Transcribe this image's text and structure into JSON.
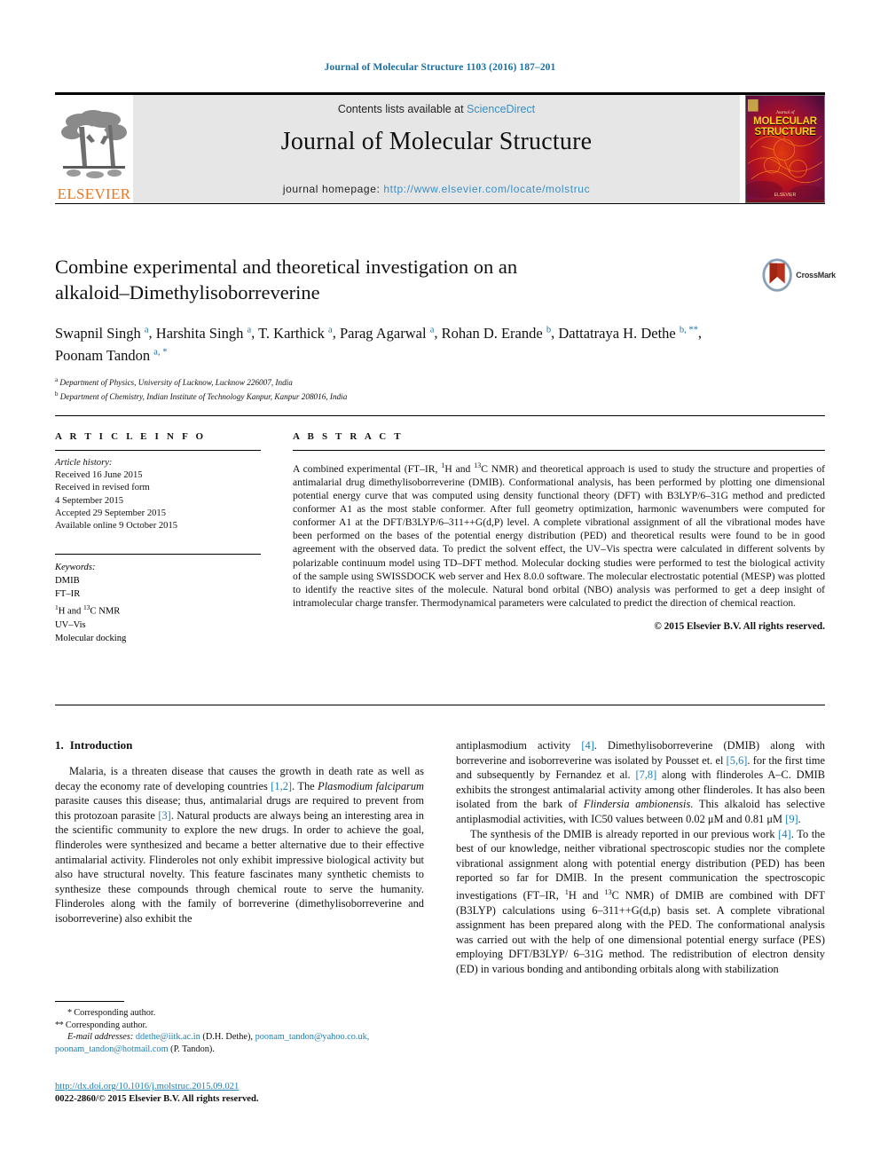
{
  "running_head": "Journal of Molecular Structure 1103 (2016) 187–201",
  "masthead": {
    "contents_prefix": "Contents lists available at ",
    "sciencedirect": "ScienceDirect",
    "journal_title": "Journal of Molecular Structure",
    "homepage_label": "journal homepage: ",
    "homepage_url": "http://www.elsevier.com/locate/molstruc",
    "publisher": "ELSEVIER",
    "cover": {
      "small_label": "Journal of",
      "line1": "MOLECULAR",
      "line2": "STRUCTURE",
      "foot": "ELSEVIER"
    },
    "accent_link_color": "#3a8fc4",
    "elsevier_orange": "#E87722"
  },
  "crossmark": {
    "label": "CrossMark"
  },
  "article": {
    "title_line1": "Combine experimental and theoretical investigation on an",
    "title_line2": "alkaloid–Dimethylisoborreverine",
    "authors": [
      {
        "name": "Swapnil Singh",
        "marks": "a",
        "sep": ", "
      },
      {
        "name": "Harshita Singh",
        "marks": "a",
        "sep": ", "
      },
      {
        "name": "T. Karthick",
        "marks": "a",
        "sep": ", "
      },
      {
        "name": "Parag Agarwal",
        "marks": "a",
        "sep": ", "
      },
      {
        "name": "Rohan D. Erande",
        "marks": "b",
        "sep": ", "
      },
      {
        "name": "Dattatraya H. Dethe",
        "marks": "b, **",
        "sep": ", "
      },
      {
        "name": "Poonam Tandon",
        "marks": "a, *",
        "sep": ""
      }
    ],
    "affiliations": [
      {
        "mark": "a",
        "text": "Department of Physics, University of Lucknow, Lucknow 226007, India"
      },
      {
        "mark": "b",
        "text": "Department of Chemistry, Indian Institute of Technology Kanpur, Kanpur 208016, India"
      }
    ]
  },
  "article_info": {
    "heading": "A R T I C L E   I N F O",
    "history_label": "Article history:",
    "history": [
      "Received 16 June 2015",
      "Received in revised form",
      "4 September 2015",
      "Accepted 29 September 2015",
      "Available online 9 October 2015"
    ],
    "keywords_label": "Keywords:",
    "keywords": [
      "DMIB",
      "FT–IR",
      "1H and 13C NMR",
      "UV–Vis",
      "Molecular docking"
    ]
  },
  "abstract": {
    "heading": "A B S T R A C T",
    "text": "A combined experimental (FT–IR, 1H and 13C NMR) and theoretical approach is used to study the structure and properties of antimalarial drug dimethylisoborreverine (DMIB). Conformational analysis, has been performed by plotting one dimensional potential energy curve that was computed using density functional theory (DFT) with B3LYP/6–31G method and predicted conformer A1 as the most stable conformer. After full geometry optimization, harmonic wavenumbers were computed for conformer A1 at the DFT/B3LYP/6–311++G(d,P) level. A complete vibrational assignment of all the vibrational modes have been performed on the bases of the potential energy distribution (PED) and theoretical results were found to be in good agreement with the observed data. To predict the solvent effect, the UV–Vis spectra were calculated in different solvents by polarizable continuum model using TD–DFT method. Molecular docking studies were performed to test the biological activity of the sample using SWISSDOCK web server and Hex 8.0.0 software. The molecular electrostatic potential (MESP) was plotted to identify the reactive sites of the molecule. Natural bond orbital (NBO) analysis was performed to get a deep insight of intramolecular charge transfer. Thermodynamical parameters were calculated to predict the direction of chemical reaction.",
    "copyright": "© 2015 Elsevier B.V. All rights reserved."
  },
  "body": {
    "section_number": "1.",
    "section_title": "Introduction",
    "left_paragraph": "Malaria, is a threaten disease that causes the growth in death rate as well as decay the economy rate of developing countries [1,2]. The Plasmodium falciparum parasite causes this disease; thus, antimalarial drugs are required to prevent from this protozoan parasite [3]. Natural products are always being an interesting area in the scientific community to explore the new drugs. In order to achieve the goal, flinderoles were synthesized and became a better alternative due to their effective antimalarial activity. Flinderoles not only exhibit impressive biological activity but also have structural novelty. This feature fascinates many synthetic chemists to synthesize these compounds through chemical route to serve the humanity. Flinderoles along with the family of borreverine (dimethylisoborreverine and isoborreverine) also exhibit the",
    "right_paragraph_1": "antiplasmodium activity [4]. Dimethylisoborreverine (DMIB) along with borreverine and isoborreverine was isolated by Pousset et. el [5,6]. for the first time and subsequently by Fernandez et al. [7,8] along with flinderoles A–C. DMIB exhibits the strongest antimalarial activity among other flinderoles. It has also been isolated from the bark of Flindersia ambionensis. This alkaloid has selective antiplasmodial activities, with IC50 values between 0.02 μM and 0.81 μM [9].",
    "right_paragraph_2": "The synthesis of the DMIB is already reported in our previous work [4]. To the best of our knowledge, neither vibrational spectroscopic studies nor the complete vibrational assignment along with potential energy distribution (PED) has been reported so far for DMIB. In the present communication the spectroscopic investigations (FT–IR, 1H and 13C NMR) of DMIB are combined with DFT (B3LYP) calculations using 6–311++G(d,p) basis set. A complete vibrational assignment has been prepared along with the PED. The conformational analysis was carried out with the help of one dimensional potential energy surface (PES) employing DFT/B3LYP/6–31G method. The redistribution of electron density (ED) in various bonding and antibonding orbitals along with stabilization"
  },
  "footnotes": {
    "corresponding_1_mark": "*",
    "corresponding_1": "Corresponding author.",
    "corresponding_2_mark": "**",
    "corresponding_2": "Corresponding author.",
    "email_label": "E-mail addresses:",
    "email_1": "ddethe@iitk.ac.in",
    "email_1_owner": "(D.H. Dethe),",
    "email_2": "poonam_tandon@yahoo.co.uk,",
    "email_3": "poonam_tandon@hotmail.com",
    "email_3_owner": "(P. Tandon)."
  },
  "doi": {
    "url": "http://dx.doi.org/10.1016/j.molstruc.2015.09.021",
    "issn_line": "0022-2860/© 2015 Elsevier B.V. All rights reserved."
  }
}
